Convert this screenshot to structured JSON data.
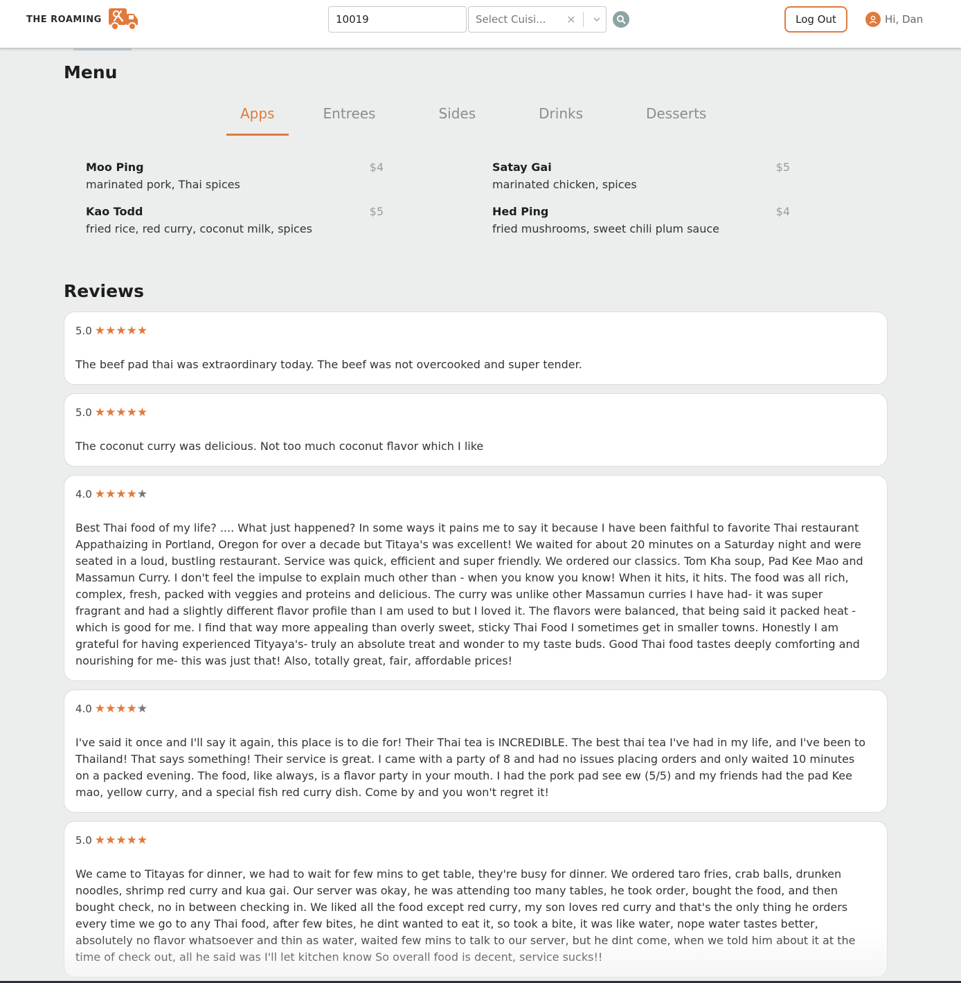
{
  "header": {
    "logo_text": "THE ROAMING",
    "zip_value": "10019",
    "cuisine_placeholder": "Select Cuisi...",
    "logout_label": "Log Out",
    "greeting": "Hi, Dan",
    "icons": [
      "food-truck-icon",
      "clear-icon",
      "chevron-down-icon",
      "search-icon",
      "user-icon"
    ]
  },
  "menu": {
    "title": "Menu",
    "tabs": [
      {
        "label": "Apps",
        "active": true
      },
      {
        "label": "Entrees",
        "active": false
      },
      {
        "label": "Sides",
        "active": false
      },
      {
        "label": "Drinks",
        "active": false
      },
      {
        "label": "Desserts",
        "active": false
      }
    ],
    "items": [
      {
        "name": "Moo Ping",
        "price": "$4",
        "desc": "marinated pork, Thai spices"
      },
      {
        "name": "Satay Gai",
        "price": "$5",
        "desc": "marinated chicken, spices"
      },
      {
        "name": "Kao Todd",
        "price": "$5",
        "desc": "fried rice, red curry, coconut milk, spices"
      },
      {
        "name": "Hed Ping",
        "price": "$4",
        "desc": "fried mushrooms, sweet chili plum sauce"
      }
    ]
  },
  "reviews": {
    "title": "Reviews",
    "items": [
      {
        "rating": "5.0",
        "stars": 5,
        "text": "The beef pad thai was extraordinary today. The beef was not overcooked and super tender."
      },
      {
        "rating": "5.0",
        "stars": 5,
        "text": "The coconut curry was delicious. Not too much coconut flavor which I like"
      },
      {
        "rating": "4.0",
        "stars": 4,
        "text": "Best Thai food of my life? .... What just happened? In some ways it pains me to say it because I have been faithful to favorite Thai restaurant Appathaizing in Portland, Oregon for over a decade but Titaya's was excellent! We waited for about 20 minutes on a Saturday night and were seated in a loud, bustling restaurant. Service was quick, efficient and super friendly. We ordered our classics. Tom Kha soup, Pad Kee Mao and Massamun Curry. I don't feel the impulse to explain much other than - when you know you know! When it hits, it hits. The food was all rich, complex, fresh, packed with veggies and proteins and delicious. The curry was unlike other Massamun curries I have had- it was super fragrant and had a slightly different flavor profile than I am used to but I loved it. The flavors were balanced, that being said it packed heat - which is good for me. I find that way more appealing than overly sweet, sticky Thai Food I sometimes get in smaller towns. Honestly I am grateful for having experienced Tityaya's- truly an absolute treat and wonder to my taste buds. Good Thai food tastes deeply comforting and nourishing for me- this was just that! Also, totally great, fair, affordable prices!"
      },
      {
        "rating": "4.0",
        "stars": 4,
        "text": "I've said it once and I'll say it again, this place is to die for! Their Thai tea is INCREDIBLE. The best thai tea I've had in my life, and I've been to Thailand! That says something! Their service is great. I came with a party of 8 and had no issues placing orders and only waited 10 minutes on a packed evening. The food, like always, is a flavor party in your mouth. I had the pork pad see ew (5/5) and my friends had the pad Kee mao, yellow curry, and a special fish red curry dish. Come by and you won't regret it!"
      },
      {
        "rating": "5.0",
        "stars": 5,
        "text": "We came to Titayas for dinner, we had to wait for few mins to get table, they're busy for dinner. We ordered taro fries, crab balls, drunken noodles, shrimp red curry and kua gai. Our server was okay, he was attending too many tables, he took order, bought the food, and then bought check, no in between checking in. We liked all the food except red curry, my son loves red curry and that's the only thing he orders every time we go to any Thai food, after few bites, he dint wanted to eat it, so took a bite, it was like water, nope water tastes better, absolutely no flavor whatsoever and thin as water, waited few mins to talk to our server, but he dint come, when we told him about it at the time of check out, all he said was I'll let kitchen know So overall food is decent, service sucks!!"
      }
    ]
  },
  "colors": {
    "accent": "#e07a3c",
    "background": "#eceeed",
    "search_button": "#8da3a6"
  }
}
